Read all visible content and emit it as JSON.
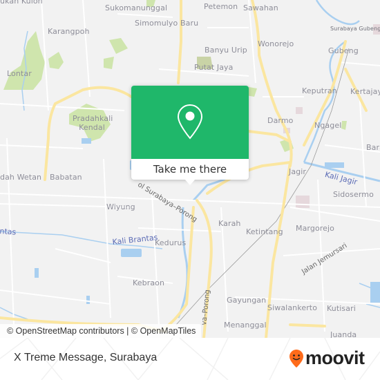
{
  "map": {
    "places": [
      {
        "label": "Sukomanunggal"
      },
      {
        "label": "Simomulyo Baru"
      },
      {
        "label": "Petemon"
      },
      {
        "label": "Sawahan"
      },
      {
        "label": "Karangpoh"
      },
      {
        "label": "Lontar"
      },
      {
        "label": "Banyu Urip"
      },
      {
        "label": "Wonorejo"
      },
      {
        "label": "Putat Jaya"
      },
      {
        "label": "Gubeng"
      },
      {
        "label": "Keputran"
      },
      {
        "label": "Kertajaya"
      },
      {
        "label": "Pradahkali Kendal"
      },
      {
        "label": "Darmo"
      },
      {
        "label": "Ngagel"
      },
      {
        "label": "Bara"
      },
      {
        "label": "Jagir"
      },
      {
        "label": "dah Wetan"
      },
      {
        "label": "Babatan"
      },
      {
        "label": "Sidosermo"
      },
      {
        "label": "Wiyung"
      },
      {
        "label": "Karah"
      },
      {
        "label": "Ketintang"
      },
      {
        "label": "Margorejo"
      },
      {
        "label": "Kedurus"
      },
      {
        "label": "Kebraon"
      },
      {
        "label": "Gayungan"
      },
      {
        "label": "Siwalankerto"
      },
      {
        "label": "Kutisari"
      },
      {
        "label": "Menanggal"
      },
      {
        "label": "ukan Kulon"
      },
      {
        "label": "Surabaya Gubeng"
      },
      {
        "label": "Juanda"
      }
    ],
    "water_labels": [
      {
        "label": "Kali Jagir"
      },
      {
        "label": "Kali Brantas"
      },
      {
        "label": "ntas"
      }
    ],
    "road_labels": [
      {
        "label": "ol Surabaya–Porong"
      },
      {
        "label": "Jalan Jemursari"
      },
      {
        "label": "va–Porong"
      }
    ],
    "attribution": "© OpenStreetMap contributors | © OpenMapTiles"
  },
  "popup": {
    "icon": "map-pin-icon",
    "cta_label": "Take me there",
    "color": "#1fb76a"
  },
  "footer": {
    "place_name": "X Treme Message, Surabaya",
    "brand": "moovit",
    "brand_color": "#ff6b1a"
  }
}
